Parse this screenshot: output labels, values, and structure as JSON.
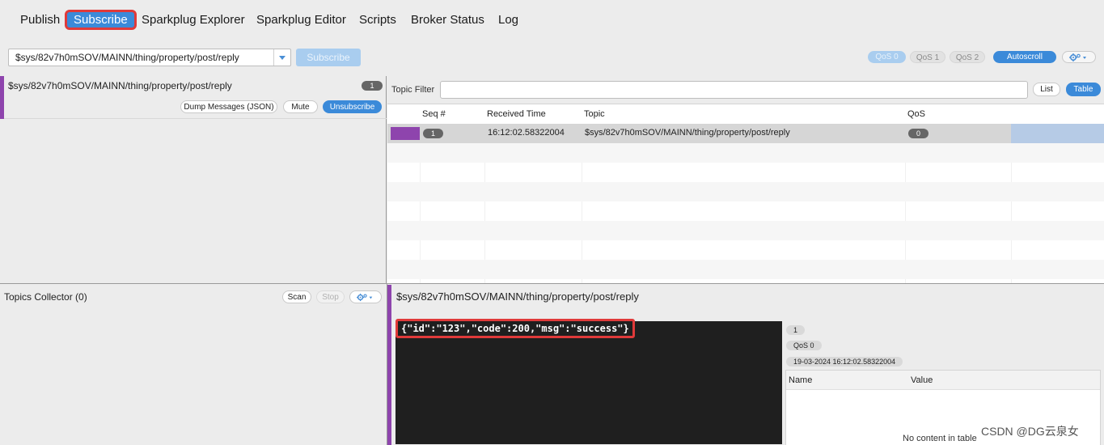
{
  "nav": {
    "items": [
      "Publish",
      "Subscribe",
      "Sparkplug Explorer",
      "Sparkplug Editor",
      "Scripts",
      "Broker Status",
      "Log"
    ],
    "active": "Subscribe"
  },
  "subscribe_bar": {
    "topic_value": "$sys/82v7h0mSOV/MAINN/thing/property/post/reply",
    "subscribe_label": "Subscribe",
    "qos_options": [
      "QoS 0",
      "QoS 1",
      "QoS 2"
    ],
    "selected_qos": "QoS 0",
    "autoscroll_label": "Autoscroll",
    "settings_icon": "gear-icon"
  },
  "subscriptions": [
    {
      "topic": "$sys/82v7h0mSOV/MAINN/thing/property/post/reply",
      "count": "1",
      "color": "#8e44ad",
      "buttons": [
        "Dump Messages (JSON)",
        "Mute",
        "Unsubscribe"
      ]
    }
  ],
  "messages": {
    "filter_label": "Topic Filter",
    "filter_value": "",
    "view_buttons": [
      "List",
      "Table"
    ],
    "active_view": "Table",
    "columns": [
      "Seq #",
      "Received Time",
      "Topic",
      "QoS"
    ],
    "rows": [
      {
        "seq": "1",
        "received": "16:12:02.58322004",
        "topic": "$sys/82v7h0mSOV/MAINN/thing/property/post/reply",
        "qos": "0",
        "color": "#8e44ad"
      }
    ]
  },
  "collector": {
    "title": "Topics Collector (0)",
    "scan_label": "Scan",
    "stop_label": "Stop"
  },
  "detail": {
    "topic": "$sys/82v7h0mSOV/MAINN/thing/property/post/reply",
    "payload": "{\"id\":\"123\",\"code\":200,\"msg\":\"success\"}",
    "seq": "1",
    "qos": "QoS 0",
    "timestamp": "19-03-2024  16:12:02.58322004",
    "props_columns": [
      "Name",
      "Value"
    ],
    "props_empty": "No content in table"
  },
  "watermark": "CSDN @DG云泉女"
}
